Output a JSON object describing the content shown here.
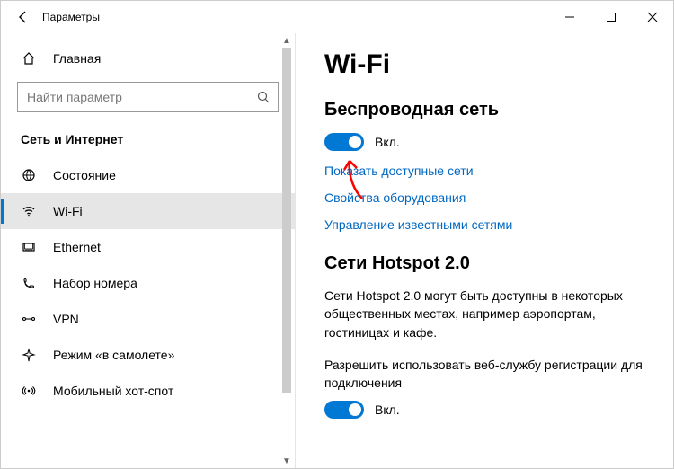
{
  "titlebar": {
    "title": "Параметры"
  },
  "sidebar": {
    "home_label": "Главная",
    "search_placeholder": "Найти параметр",
    "section_title": "Сеть и Интернет",
    "items": [
      {
        "label": "Состояние"
      },
      {
        "label": "Wi-Fi"
      },
      {
        "label": "Ethernet"
      },
      {
        "label": "Набор номера"
      },
      {
        "label": "VPN"
      },
      {
        "label": "Режим «в самолете»"
      },
      {
        "label": "Мобильный хот-спот"
      }
    ]
  },
  "content": {
    "heading": "Wi-Fi",
    "wireless_heading": "Беспроводная сеть",
    "toggle1_label": "Вкл.",
    "link_show_networks": "Показать доступные сети",
    "link_hardware_props": "Свойства оборудования",
    "link_manage_known": "Управление известными сетями",
    "hotspot_heading": "Сети Hotspot 2.0",
    "hotspot_para": "Сети Hotspot 2.0 могут быть доступны в некоторых общественных местах, например аэропортам, гостиницах и кафе.",
    "hotspot_allow": "Разрешить использовать веб-службу регистрации для подключения",
    "toggle2_label": "Вкл."
  }
}
